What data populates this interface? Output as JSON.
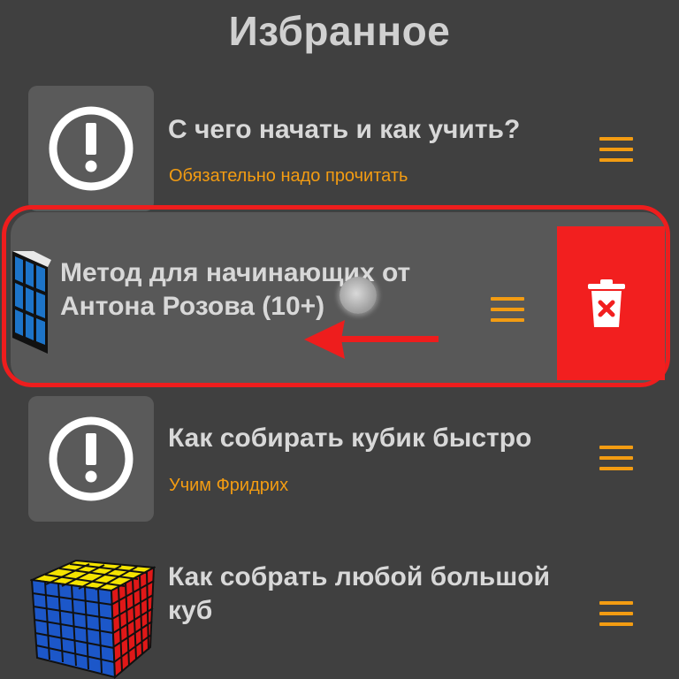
{
  "header": {
    "title": "Избранное"
  },
  "items": [
    {
      "title": "С чего начать и как учить?",
      "subtitle": "Обязательно надо прочитать",
      "icon": "exclamation-icon"
    },
    {
      "title_line1": "Метод для начинающих от",
      "title_line2": "Антона Розова (10+)",
      "icon": "cube-3x3-icon"
    },
    {
      "title": "Как собирать кубик быстро",
      "subtitle": "Учим Фридрих",
      "icon": "exclamation-icon"
    },
    {
      "title_line1": "Как собрать любой большой",
      "title_line2": "куб",
      "icon": "cube-big-icon"
    }
  ],
  "swipe": {
    "action": "delete",
    "icon": "trash-icon"
  },
  "colors": {
    "background": "#404040",
    "accent": "#f39c12",
    "delete": "#f21f1f",
    "card": "#5a5a5a"
  }
}
